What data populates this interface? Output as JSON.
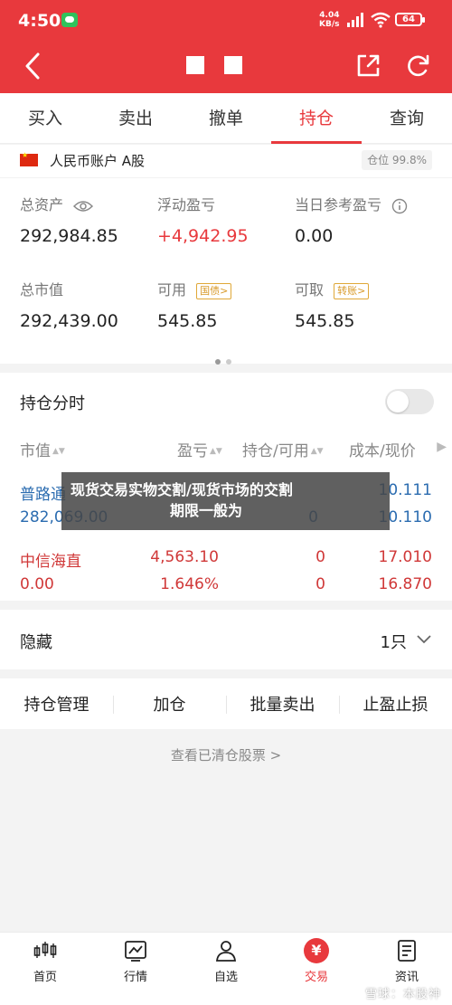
{
  "status": {
    "time": "4:50",
    "net_speed_value": "4.04",
    "net_speed_unit": "KB/s",
    "battery": "64"
  },
  "tabs": [
    {
      "label": "买入"
    },
    {
      "label": "卖出"
    },
    {
      "label": "撤单"
    },
    {
      "label": "持仓",
      "active": true
    },
    {
      "label": "查询"
    }
  ],
  "account": {
    "name": "人民币账户 A股",
    "position_badge": "仓位 99.8%",
    "metrics": {
      "total_assets": {
        "label": "总资产",
        "value": "292,984.85"
      },
      "floating_pnl": {
        "label": "浮动盈亏",
        "value": "+4,942.95"
      },
      "daily_pnl": {
        "label": "当日参考盈亏",
        "value": "0.00"
      },
      "market_value": {
        "label": "总市值",
        "value": "292,439.00"
      },
      "available": {
        "label": "可用",
        "tag": "国债>",
        "value": "545.85"
      },
      "withdrawable": {
        "label": "可取",
        "tag": "转账>",
        "value": "545.85"
      }
    }
  },
  "holdings": {
    "title": "持仓分时",
    "columns": [
      "市值",
      "盈亏",
      "持仓/可用",
      "成本/现价"
    ],
    "rows": [
      {
        "name": "普路通",
        "market_value": "282,069.00",
        "pnl": "",
        "pnl_pct": "",
        "hold": "",
        "avail": "0",
        "cost": "10.111",
        "price": "10.110",
        "tone": "blue"
      },
      {
        "name": "中信海直",
        "market_value": "0.00",
        "pnl": "4,563.10",
        "pnl_pct": "1.646%",
        "hold": "0",
        "avail": "0",
        "cost": "17.010",
        "price": "16.870",
        "tone": "red"
      }
    ]
  },
  "hidden": {
    "label": "隐藏",
    "count": "1只"
  },
  "actions": [
    "持仓管理",
    "加仓",
    "批量卖出",
    "止盈止损"
  ],
  "cleared_link": "查看已清仓股票 >",
  "banner": {
    "line1": "现货交易实物交割/现货市场的交割",
    "line2": "期限一般为"
  },
  "nav": [
    {
      "label": "首页",
      "icon": "candlestick-icon"
    },
    {
      "label": "行情",
      "icon": "chart-icon"
    },
    {
      "label": "自选",
      "icon": "user-icon"
    },
    {
      "label": "交易",
      "icon": "yuan-icon",
      "active": true
    },
    {
      "label": "资讯",
      "icon": "news-icon"
    }
  ],
  "credit": "雪球：本股神",
  "colors": {
    "brand_red": "#e8393d",
    "blue": "#2b6cb0"
  }
}
